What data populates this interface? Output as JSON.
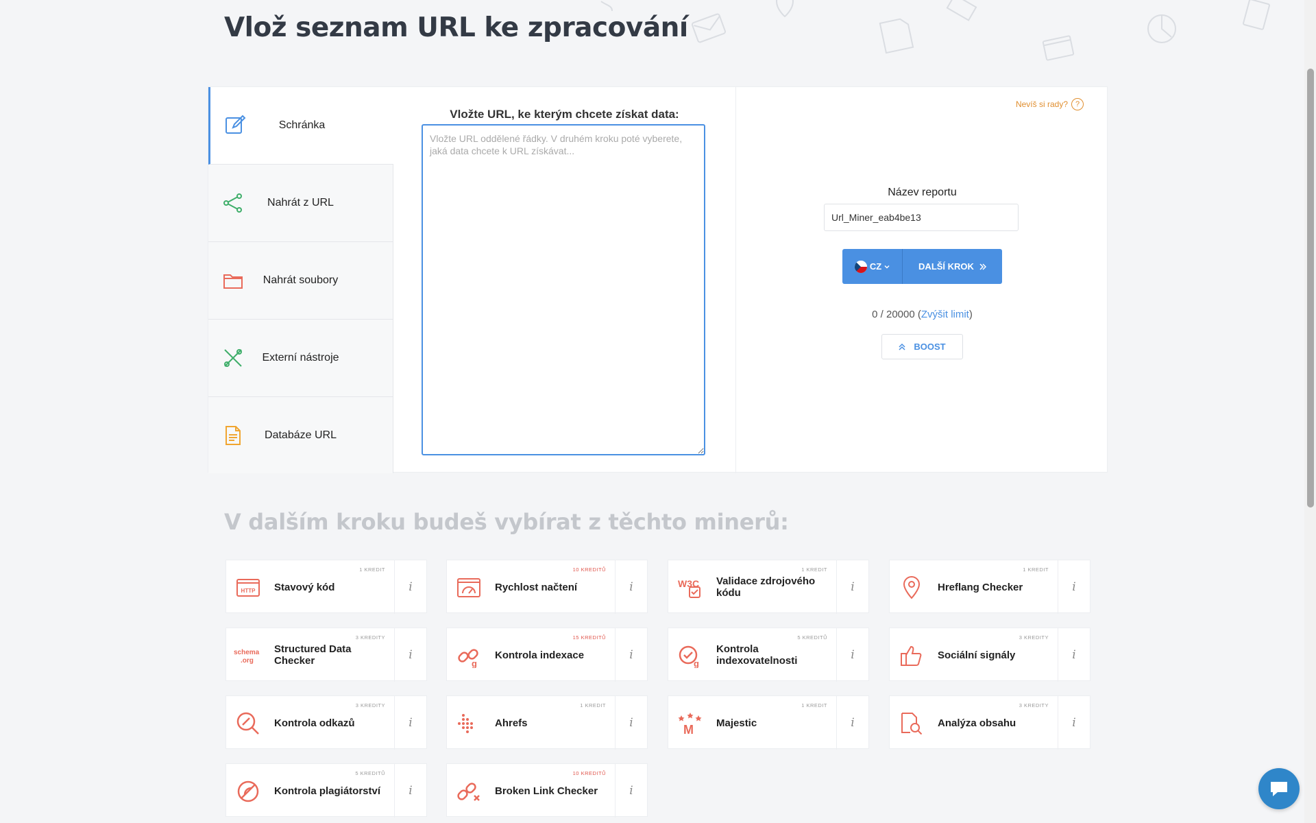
{
  "page": {
    "title": "Vlož seznam URL ke zpracování",
    "section_title": "V dalším kroku budeš vybírat z těchto minerů:"
  },
  "sources": [
    {
      "label": "Schránka",
      "icon": "edit-icon",
      "active": true
    },
    {
      "label": "Nahrát z URL",
      "icon": "share-icon",
      "active": false
    },
    {
      "label": "Nahrát soubory",
      "icon": "folder-icon",
      "active": false
    },
    {
      "label": "Externí nástroje",
      "icon": "tools-icon",
      "active": false
    },
    {
      "label": "Databáze URL",
      "icon": "document-icon",
      "active": false
    }
  ],
  "url_input": {
    "label": "Vložte URL, ke kterým chcete získat data:",
    "placeholder": "Vložte URL oddělené řádky. V druhém kroku poté vyberete, jaká data chcete k URL získávat...",
    "value": ""
  },
  "help": {
    "label": "Nevíš si rady?",
    "icon": "question-icon"
  },
  "report": {
    "label": "Název reportu",
    "value": "Url_Miner_eab4be13"
  },
  "language": {
    "value": "CZ",
    "icon": "czech-flag-icon"
  },
  "next_button": {
    "label": "DALŠÍ KROK"
  },
  "limit": {
    "count": "0 / 20000 (",
    "link": "Zvýšit limit",
    "close": ")"
  },
  "boost": {
    "label": "BOOST"
  },
  "miners": [
    {
      "name": "Stavový kód",
      "credit": "1 KREDIT",
      "hot": false,
      "icon": "http-icon"
    },
    {
      "name": "Rychlost načtení",
      "credit": "10 KREDITŮ",
      "hot": true,
      "icon": "speed-icon"
    },
    {
      "name": "Validace zdrojového kódu",
      "credit": "1 KREDIT",
      "hot": false,
      "icon": "w3c-icon"
    },
    {
      "name": "Hreflang Checker",
      "credit": "1 KREDIT",
      "hot": false,
      "icon": "location-pin-icon"
    },
    {
      "name": "Structured Data Checker",
      "credit": "3 KREDITY",
      "hot": false,
      "icon": "schema-org-icon"
    },
    {
      "name": "Kontrola indexace",
      "credit": "15 KREDITŮ",
      "hot": true,
      "icon": "index-link-icon"
    },
    {
      "name": "Kontrola indexovatelnosti",
      "credit": "5 KREDITŮ",
      "hot": false,
      "icon": "indexability-icon"
    },
    {
      "name": "Sociální signály",
      "credit": "3 KREDITY",
      "hot": false,
      "icon": "thumbs-up-icon"
    },
    {
      "name": "Kontrola odkazů",
      "credit": "3 KREDITY",
      "hot": false,
      "icon": "link-search-icon"
    },
    {
      "name": "Ahrefs",
      "credit": "1 KREDIT",
      "hot": false,
      "icon": "ahrefs-icon"
    },
    {
      "name": "Majestic",
      "credit": "1 KREDIT",
      "hot": false,
      "icon": "majestic-icon"
    },
    {
      "name": "Analýza obsahu",
      "credit": "3 KREDITY",
      "hot": false,
      "icon": "content-analysis-icon"
    },
    {
      "name": "Kontrola plagiátorství",
      "credit": "5 KREDITŮ",
      "hot": false,
      "icon": "plagiarism-icon"
    },
    {
      "name": "Broken Link Checker",
      "credit": "10 KREDITŮ",
      "hot": true,
      "icon": "broken-link-icon"
    }
  ],
  "miner_info_label": "i",
  "colors": {
    "accent": "#4a90e2",
    "miner_icon": "#e96a5a",
    "help": "#e08e2f"
  }
}
